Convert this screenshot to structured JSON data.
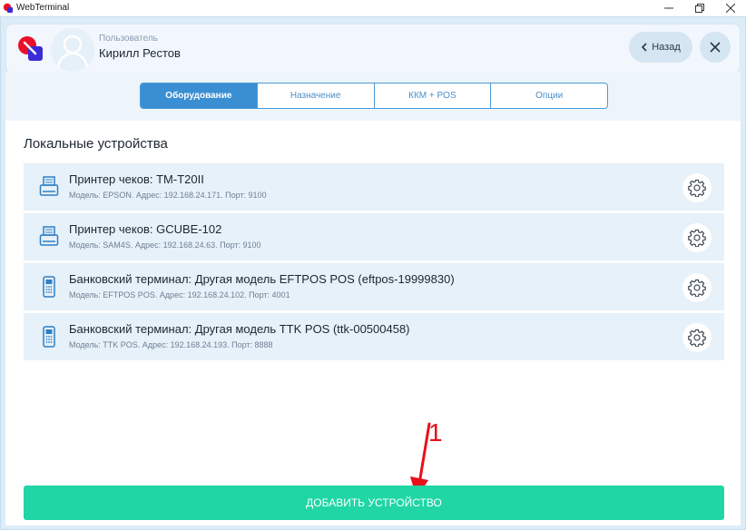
{
  "window": {
    "title": "WebTerminal",
    "controls": [
      "minimize-icon",
      "restore-icon",
      "close-icon"
    ]
  },
  "header": {
    "user_caption": "Пользователь",
    "user_name": "Кирилл Рестов",
    "back_label": "Назад"
  },
  "tabs": [
    {
      "label": "Оборудование",
      "active": true
    },
    {
      "label": "Назначение",
      "active": false
    },
    {
      "label": "ККМ + POS",
      "active": false
    },
    {
      "label": "Опции",
      "active": false
    }
  ],
  "main": {
    "section_title": "Локальные устройства",
    "devices": [
      {
        "icon": "receipt-printer-icon",
        "title": "Принтер чеков: TM-T20II",
        "meta": "Модель: EPSON. Адрес: 192.168.24.171. Порт: 9100"
      },
      {
        "icon": "receipt-printer-icon",
        "title": "Принтер чеков: GCUBE-102",
        "meta": "Модель: SAM4S. Адрес: 192.168.24.63. Порт: 9100"
      },
      {
        "icon": "pos-terminal-icon",
        "title": "Банковский терминал: Другая модель EFTPOS POS (eftpos-19999830)",
        "meta": "Модель: EFTPOS POS. Адрес: 192.168.24.102. Порт: 4001"
      },
      {
        "icon": "pos-terminal-icon",
        "title": "Банковский терминал: Другая модель TTK POS (ttk-00500458)",
        "meta": "Модель: TTK POS. Адрес: 192.168.24.193. Порт: 8888"
      }
    ],
    "annotation": "1",
    "add_button_label": "ДОБАВИТЬ УСТРОЙСТВО"
  },
  "colors": {
    "accent_blue": "#3a8fd3",
    "add_button": "#1fd6a4",
    "annotation_red": "#e8101a"
  }
}
